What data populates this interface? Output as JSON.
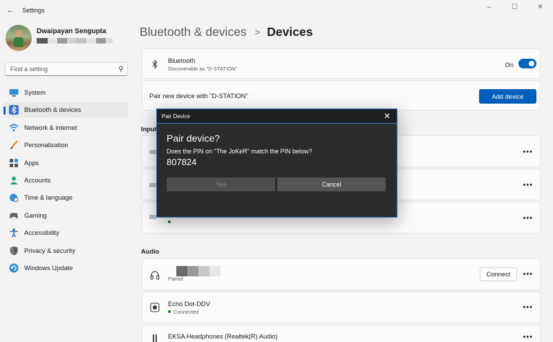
{
  "window": {
    "title": "Settings",
    "controls": [
      "minimize",
      "maximize",
      "close"
    ]
  },
  "profile": {
    "name": "Dwaipayan Sengupta",
    "email_redacted": true
  },
  "search": {
    "placeholder": "Find a setting"
  },
  "sidebar": {
    "items": [
      {
        "label": "System",
        "icon": "monitor-icon",
        "active": false
      },
      {
        "label": "Bluetooth & devices",
        "icon": "bluetooth-icon",
        "active": true
      },
      {
        "label": "Network & internet",
        "icon": "wifi-icon",
        "active": false
      },
      {
        "label": "Personalization",
        "icon": "brush-icon",
        "active": false
      },
      {
        "label": "Apps",
        "icon": "apps-icon",
        "active": false
      },
      {
        "label": "Accounts",
        "icon": "person-icon",
        "active": false
      },
      {
        "label": "Time & language",
        "icon": "globe-clock-icon",
        "active": false
      },
      {
        "label": "Gaming",
        "icon": "gamepad-icon",
        "active": false
      },
      {
        "label": "Accessibility",
        "icon": "accessibility-icon",
        "active": false
      },
      {
        "label": "Privacy & security",
        "icon": "shield-icon",
        "active": false
      },
      {
        "label": "Windows Update",
        "icon": "update-icon",
        "active": false
      }
    ]
  },
  "breadcrumb": {
    "parent": "Bluetooth & devices",
    "separator": ">",
    "current": "Devices"
  },
  "bluetooth": {
    "title": "Bluetooth",
    "subtitle": "Discoverable as \"D-STATION\"",
    "state_label": "On",
    "enabled": true
  },
  "pair": {
    "label": "Pair new device with \"D-STATION\"",
    "button": "Add device"
  },
  "sections": {
    "input": "Input",
    "audio": "Audio"
  },
  "audio_devices": [
    {
      "name": "",
      "status": "Paired",
      "icon": "headphones-icon",
      "action": "Connect"
    },
    {
      "name": "Echo Dot-DDV",
      "status": "Connected",
      "icon": "speaker-icon",
      "action": ""
    },
    {
      "name": "EKSA Headphones (Realtek(R) Audio)",
      "status": "",
      "icon": "headphones-icon",
      "action": ""
    }
  ],
  "more_label": "•••",
  "dialog": {
    "title": "Pair Device",
    "close": "✕",
    "heading": "Pair device?",
    "question": "Does the PIN on \"The JoKeR\" match the PIN below?",
    "pin": "807824",
    "yes": "Yes",
    "cancel": "Cancel"
  },
  "colors": {
    "accent": "#005fb8",
    "toggle_on": "#0067c0",
    "dialog_bg": "#2b2b2b",
    "dialog_border": "#3b7bc4",
    "connected_dot": "#107c10"
  }
}
